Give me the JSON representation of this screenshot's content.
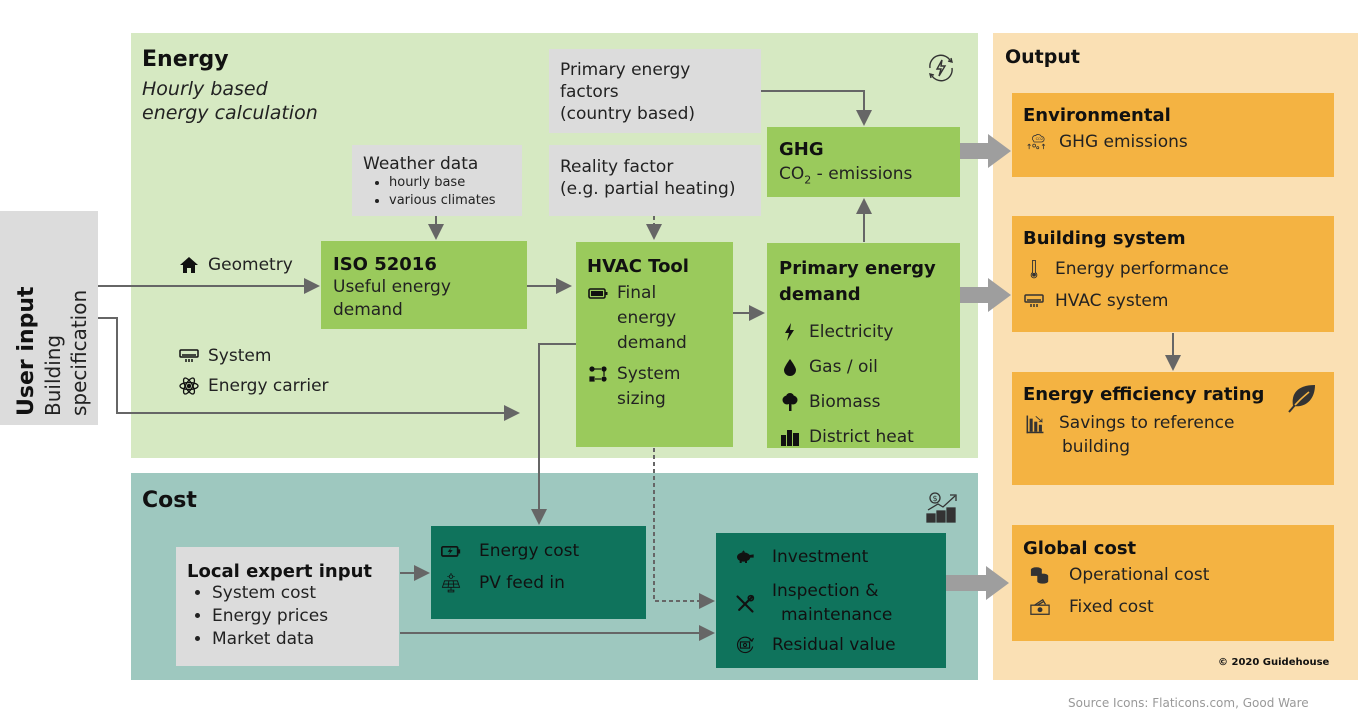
{
  "energy": {
    "title": "Energy",
    "subtitle_line1": "Hourly based",
    "subtitle_line2": "energy calculation",
    "primary_factors": [
      "Primary energy",
      "factors",
      "(country based)"
    ],
    "weather": {
      "title": "Weather data",
      "bullets": [
        "hourly base",
        "various climates"
      ]
    },
    "reality": [
      "Reality factor",
      "(e.g. partial heating)"
    ],
    "ghg": {
      "title": "GHG",
      "co": "CO",
      "sub": "2",
      "rest": " - emissions"
    },
    "inputs": {
      "geometry": "Geometry",
      "system": "System",
      "carrier": "Energy carrier"
    },
    "iso": {
      "title": "ISO 52016",
      "line1": "Useful energy",
      "line2": "demand"
    },
    "hvac": {
      "title": "HVAC Tool",
      "final": [
        "Final",
        "energy",
        "demand"
      ],
      "sizing": [
        "System",
        "sizing"
      ]
    },
    "primary_demand": {
      "title1": "Primary energy",
      "title2": "demand",
      "items": [
        "Electricity",
        "Gas / oil",
        "Biomass",
        "District heat"
      ]
    }
  },
  "user_input": {
    "title": "User input",
    "line1": "Building",
    "line2": "specification"
  },
  "cost": {
    "title": "Cost",
    "local": {
      "title": "Local expert input",
      "bullets": [
        "System cost",
        "Energy prices",
        "Market data"
      ]
    },
    "energy_cost": {
      "items": [
        "Energy cost",
        "PV feed in"
      ]
    },
    "invest": {
      "investment": "Investment",
      "inspection1": "Inspection &",
      "inspection2": "maintenance",
      "residual": "Residual value"
    }
  },
  "output": {
    "title": "Output",
    "environmental": {
      "title": "Environmental",
      "item": "GHG emissions"
    },
    "building": {
      "title": "Building system",
      "items": [
        "Energy performance",
        "HVAC system"
      ]
    },
    "rating": {
      "title": "Energy efficiency rating",
      "line1": "Savings to reference",
      "line2": "building"
    },
    "global": {
      "title": "Global cost",
      "items": [
        "Operational cost",
        "Fixed cost"
      ]
    },
    "copyright": "© 2020 Guidehouse"
  },
  "footer": {
    "source": "Source Icons: Flaticons.com, Good Ware"
  },
  "colors": {
    "energy_bg": "#d6e9c2",
    "cost_bg": "#9ec8bf",
    "output_bg": "#fae0b4",
    "green_box": "#9aca5c",
    "teal_box": "#0f735c",
    "orange_box": "#f4b342",
    "grey_box": "#dcdcdc"
  }
}
